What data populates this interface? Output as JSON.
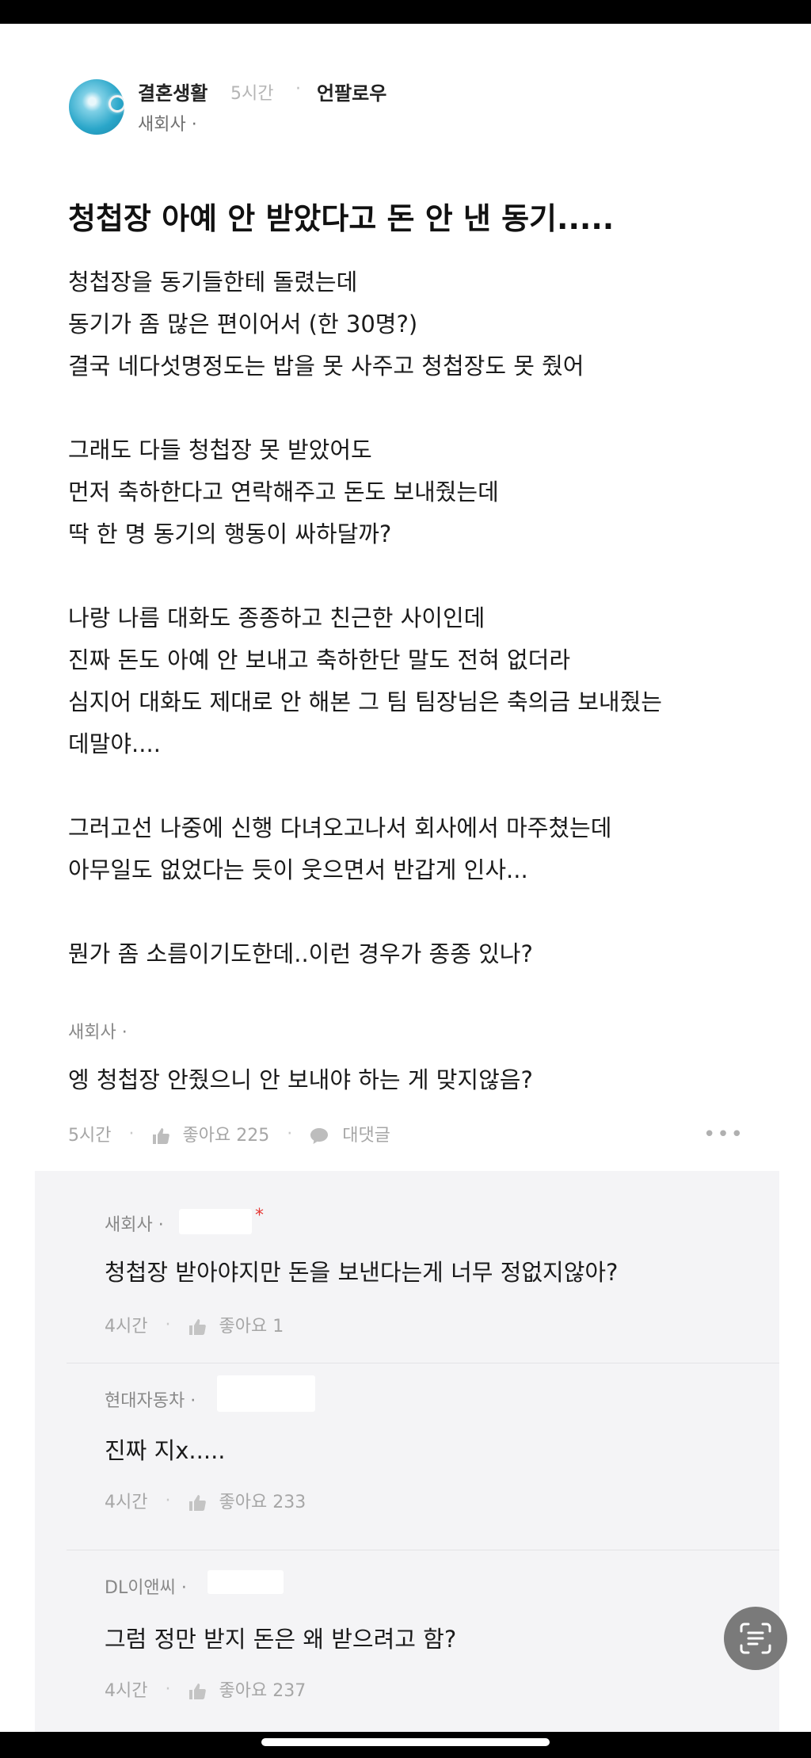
{
  "header": {
    "board_name": "결혼생활",
    "post_time": "5시간",
    "separator": "·",
    "follow_label": "언팔로우",
    "author_company": "새회사 ·"
  },
  "post": {
    "title": "청첩장 아예 안 받았다고 돈 안 낸 동기.....",
    "body_lines": [
      "청첩장을 동기들한테 돌렸는데",
      "동기가 좀 많은 편이어서 (한 30명?)",
      "결국 네다섯명정도는 밥을 못 사주고 청첩장도 못 줬어",
      "",
      "그래도 다들 청첩장 못 받았어도",
      "먼저 축하한다고 연락해주고 돈도 보내줬는데",
      "딱 한 명 동기의 행동이 싸하달까?",
      "",
      "나랑 나름 대화도 종종하고 친근한 사이인데",
      "진짜 돈도 아예 안 보내고 축하한단 말도 전혀 없더라",
      "심지어 대화도 제대로 안 해본 그 팀 팀장님은 축의금 보내줬는",
      "데말야....",
      "",
      "그러고선 나중에 신행 다녀오고나서 회사에서 마주쳤는데",
      "아무일도 없었다는 듯이 웃으면서 반갑게 인사...",
      "",
      "뭔가 좀 소름이기도한데..이런 경우가 종종 있나?"
    ]
  },
  "top_comment": {
    "company": "새회사 ·",
    "text": "엥 청첩장 안줬으니 안 보내야 하는 게 맞지않음?",
    "time": "5시간",
    "like_label": "좋아요 225",
    "reply_label": "대댓글",
    "more": "•••"
  },
  "replies": [
    {
      "company": "새회사 ·",
      "star": "*",
      "text": "청첩장 받아야지만 돈을 보낸다는게 너무 정없지않아?",
      "time": "4시간",
      "like_label": "좋아요 1"
    },
    {
      "company": "현대자동차 ·",
      "text": "진짜 지x.....",
      "time": "4시간",
      "like_label": "좋아요 233"
    },
    {
      "company": "DL이앤씨 ·",
      "text": "그럼 정만 받지 돈은 왜 받으려고 함?",
      "time": "4시간",
      "like_label": "좋아요 237"
    }
  ],
  "colors": {
    "reply_panel_bg": "#f4f4f6",
    "star_red": "#e53935",
    "meta_gray": "#a6a6a6"
  },
  "icons": [
    "thumbs-up-icon",
    "speech-bubble-icon",
    "more-dots-icon",
    "text-scan-icon"
  ]
}
